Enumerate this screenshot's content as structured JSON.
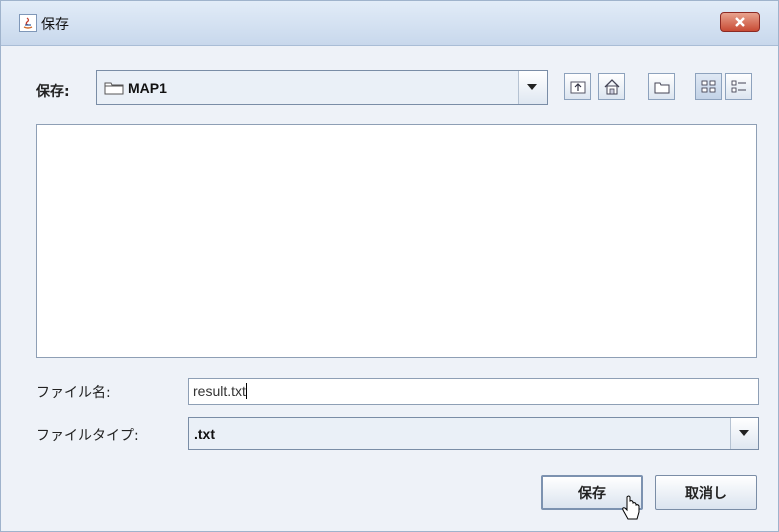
{
  "window": {
    "title": "保存"
  },
  "save_in": {
    "label": "保存:",
    "value": "MAP1"
  },
  "toolbar": {
    "buttons": [
      {
        "icon": "up-folder-icon"
      },
      {
        "icon": "home-icon"
      },
      {
        "icon": "new-folder-icon"
      },
      {
        "icon": "list-view-icon"
      },
      {
        "icon": "details-view-icon"
      }
    ]
  },
  "file_name": {
    "label": "ファイル名:",
    "value": "result.txt"
  },
  "file_type": {
    "label": "ファイルタイプ:",
    "value": ".txt"
  },
  "buttons": {
    "save": "保存",
    "cancel": "取消し"
  }
}
